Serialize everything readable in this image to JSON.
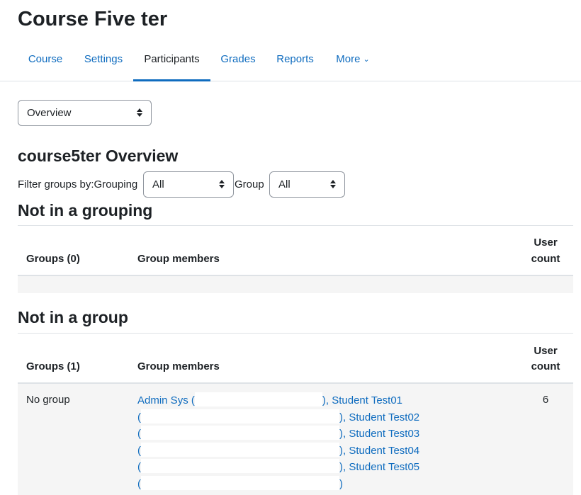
{
  "course": {
    "title": "Course Five ter"
  },
  "nav": {
    "tabs": [
      {
        "label": "Course"
      },
      {
        "label": "Settings"
      },
      {
        "label": "Participants"
      },
      {
        "label": "Grades"
      },
      {
        "label": "Reports"
      },
      {
        "label": "More"
      }
    ],
    "active": "Participants"
  },
  "report_select": {
    "value": "Overview"
  },
  "overview": {
    "title": "course5ter Overview",
    "filter_label": "Filter groups by:",
    "grouping_label": "Grouping",
    "grouping_value": "All",
    "group_label": "Group",
    "group_value": "All"
  },
  "not_in_grouping": {
    "title": "Not in a grouping",
    "col_groups": "Groups (0)",
    "col_members": "Group members",
    "col_count_1": "User",
    "col_count_2": "count"
  },
  "not_in_group": {
    "title": "Not in a group",
    "col_groups": "Groups (1)",
    "col_members": "Group members",
    "col_count_1": "User",
    "col_count_2": "count",
    "row": {
      "group_name": "No group",
      "user_count": "6",
      "members": [
        {
          "pre": "",
          "name": "Admin Sys",
          "open": " (",
          "close": ")",
          "sep": ", "
        },
        {
          "name": "Student Test01",
          "open": "(",
          "close": ")",
          "sep": ", "
        },
        {
          "name": "Student Test02",
          "open": "(",
          "close": ")",
          "sep": ", "
        },
        {
          "name": "Student Test03",
          "open": "(",
          "close": ")",
          "sep": ", "
        },
        {
          "name": "Student Test04",
          "open": "(",
          "close": ")",
          "sep": ", "
        },
        {
          "name": "Student Test05",
          "open": "(",
          "close": ")",
          "sep": ""
        }
      ]
    }
  }
}
